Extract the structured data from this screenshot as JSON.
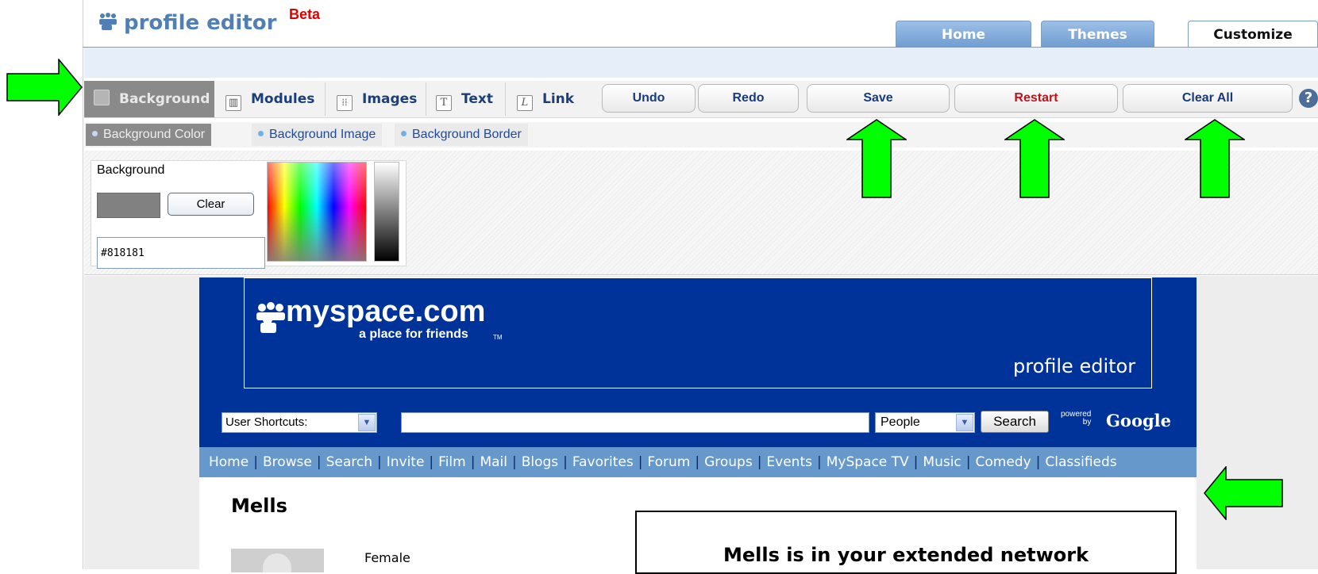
{
  "header": {
    "title": "profile editor",
    "badge": "Beta",
    "tabs": [
      {
        "label": "Home",
        "active": false
      },
      {
        "label": "Themes",
        "active": false
      },
      {
        "label": "Customize",
        "active": true
      }
    ]
  },
  "toolbar": {
    "tabs": [
      {
        "label": "Background",
        "icon": "background-icon",
        "active": true
      },
      {
        "label": "Modules",
        "icon": "modules-icon",
        "glyph": "▥",
        "active": false
      },
      {
        "label": "Images",
        "icon": "images-icon",
        "glyph": "⁞⁞",
        "active": false
      },
      {
        "label": "Text",
        "icon": "text-icon",
        "glyph": "T",
        "active": false
      },
      {
        "label": "Link",
        "icon": "link-icon",
        "glyph": "L",
        "active": false
      }
    ],
    "actions": {
      "undo": "Undo",
      "redo": "Redo",
      "save": "Save",
      "restart": "Restart",
      "clear_all": "Clear All"
    },
    "help_glyph": "?"
  },
  "subtabs": [
    {
      "label": "Background Color",
      "active": true
    },
    {
      "label": "Background Image",
      "active": false
    },
    {
      "label": "Background Border",
      "active": false
    }
  ],
  "color_editor": {
    "label": "Background",
    "clear_label": "Clear",
    "hex_value": "#818181",
    "swatch_color": "#818181"
  },
  "preview": {
    "logo_text": "myspace.com",
    "tagline": "a place for friends",
    "tagline_mark": "TM",
    "editor_label": "profile editor",
    "shortcuts_label": "User Shortcuts:",
    "search_value": "",
    "search_scope": "People",
    "search_button": "Search",
    "powered_line1": "powered",
    "powered_line2": "by",
    "google_label": "Google",
    "nav_links": [
      "Home",
      "Browse",
      "Search",
      "Invite",
      "Film",
      "Mail",
      "Blogs",
      "Favorites",
      "Forum",
      "Groups",
      "Events",
      "MySpace TV",
      "Music",
      "Comedy",
      "Classifieds"
    ],
    "profile_name": "Mells",
    "gender": "Female",
    "network_message": "Mells is in your extended network"
  },
  "colors": {
    "annotation_arrow": "#00ff00",
    "myspace_blue": "#003399",
    "nav_blue": "#6698cb",
    "restart_red": "#c1121a",
    "beta_red": "#e00000"
  }
}
